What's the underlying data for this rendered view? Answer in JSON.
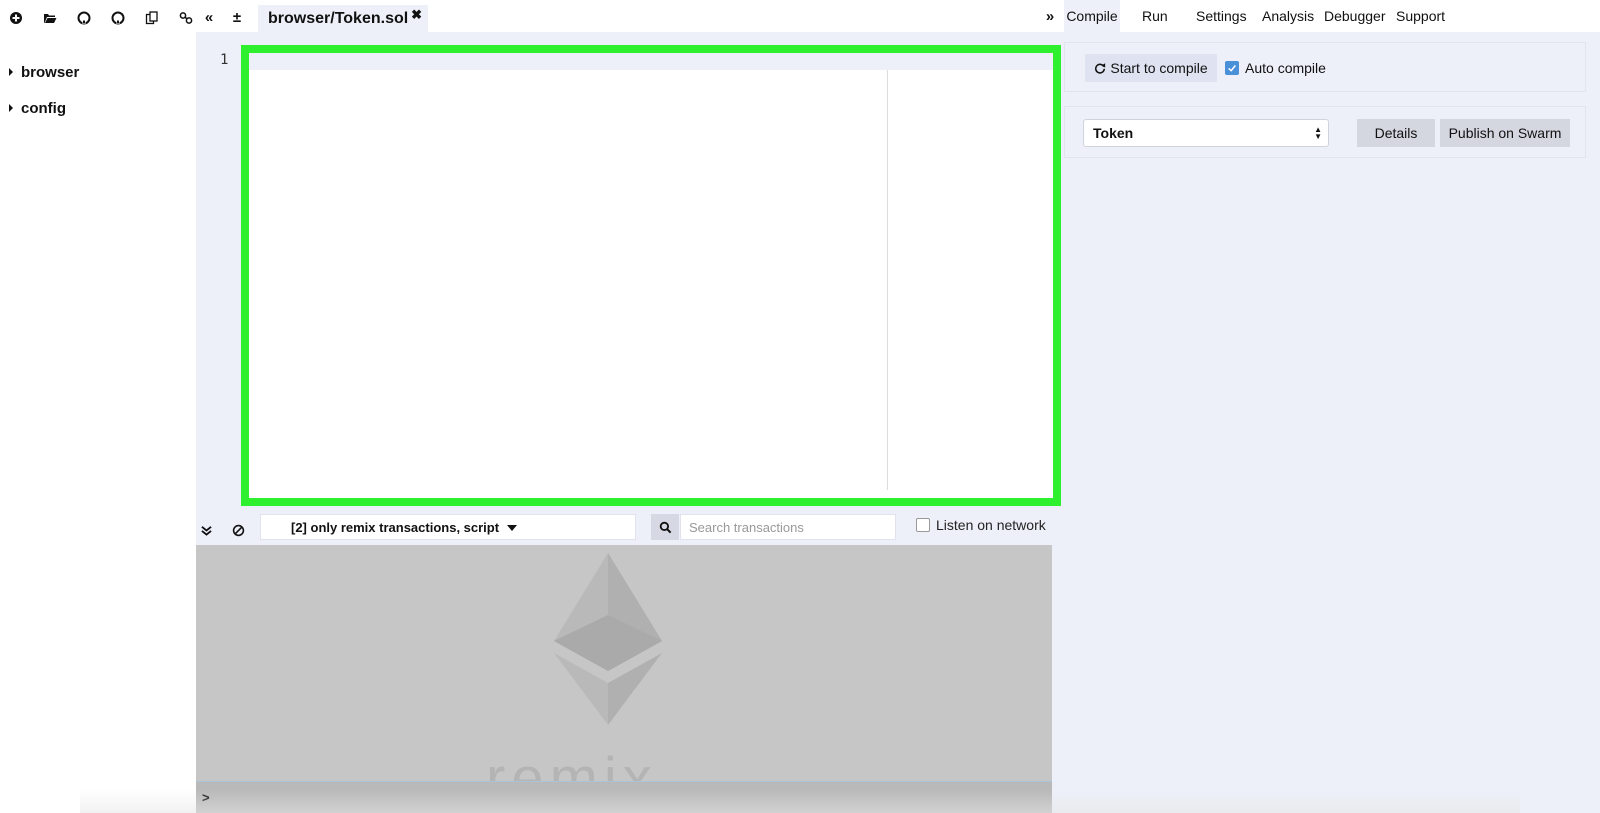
{
  "file_explorer": {
    "toolbar_icons": [
      "create-file-icon",
      "open-folder-icon",
      "github-publish-icon",
      "github-icon",
      "copy-icon",
      "link-icon"
    ],
    "tree": [
      {
        "label": "browser"
      },
      {
        "label": "config"
      }
    ]
  },
  "editor": {
    "tab_label": "browser/Token.sol",
    "line_numbers": [
      "1"
    ],
    "highlight_color": "#2ff02f"
  },
  "terminal": {
    "filter_label": "[2] only remix transactions, script",
    "search_placeholder": "Search transactions",
    "listen_label": "Listen on network",
    "prompt": ">",
    "watermark": "remix"
  },
  "right_panel": {
    "tabs": [
      {
        "label": "Compile",
        "active": true
      },
      {
        "label": "Run"
      },
      {
        "label": "Settings"
      },
      {
        "label": "Analysis"
      },
      {
        "label": "Debugger"
      },
      {
        "label": "Support"
      }
    ],
    "compile_button": "Start to compile",
    "auto_compile_label": "Auto compile",
    "auto_compile_checked": true,
    "contract_selected": "Token",
    "details_button": "Details",
    "publish_button": "Publish on Swarm"
  }
}
